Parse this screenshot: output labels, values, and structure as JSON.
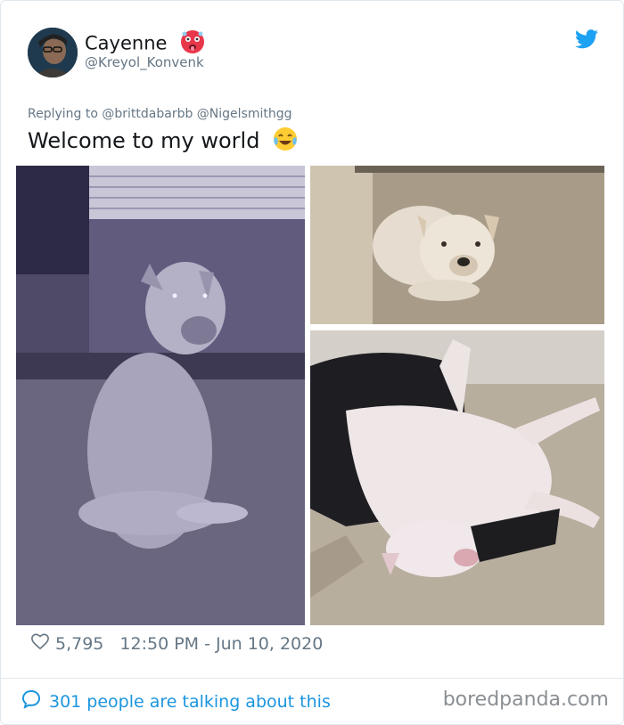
{
  "tweet": {
    "author_name": "Cayenne",
    "author_handle": "@Kreyol_Konvenk",
    "replying_to": "Replying to @brittdabarbb @Nigelsmithgg",
    "text": "Welcome to my world",
    "likes": "5,795",
    "timestamp": "12:50 PM - Jun 10, 2020",
    "talking": "301 people are talking about this"
  },
  "icons": {
    "name_emoji": "hot-face-emoji-icon",
    "text_emoji": "tears-of-joy-emoji-icon",
    "platform": "twitter-bird-icon",
    "likes": "heart-icon",
    "talking": "speech-bubble-icon"
  },
  "media": [
    {
      "description": "photo-dog-sitting"
    },
    {
      "description": "photo-dog-lying"
    },
    {
      "description": "photo-dog-rolling"
    }
  ],
  "branding": {
    "site": "boredpanda.com"
  },
  "colors": {
    "link_blue": "#1b95e0",
    "muted_gray": "#657786",
    "twitter_blue": "#1da1f2"
  }
}
